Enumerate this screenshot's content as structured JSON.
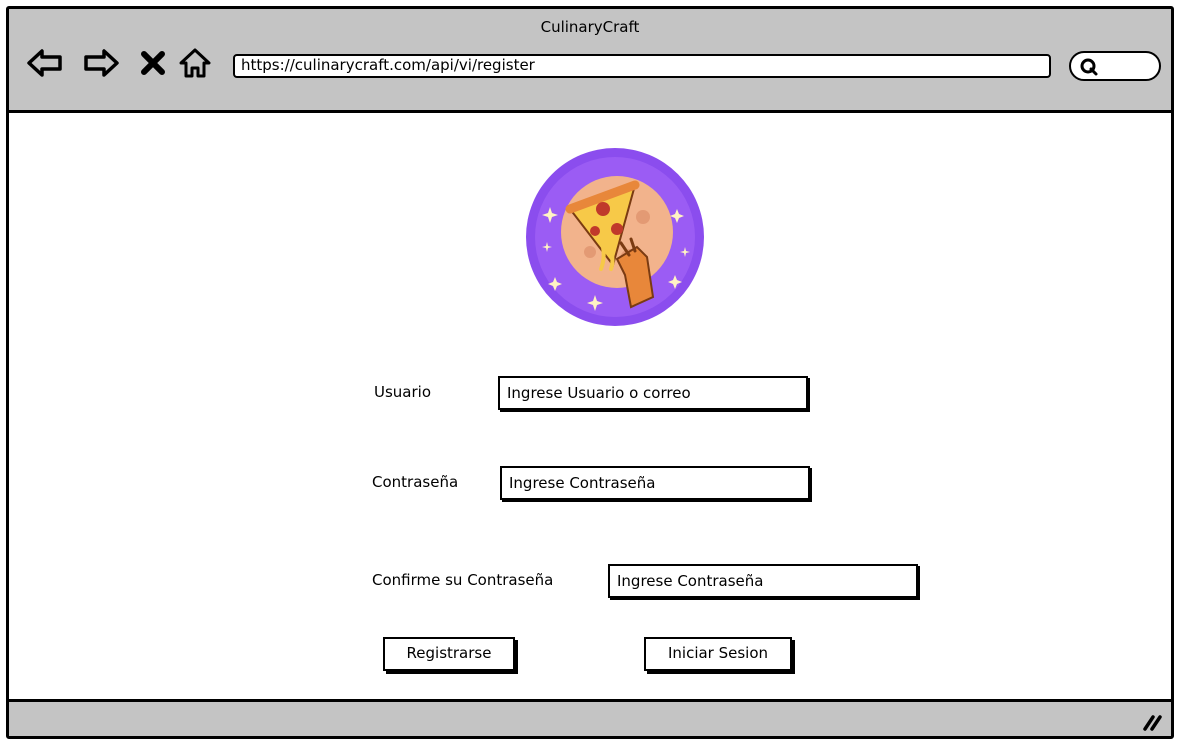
{
  "window": {
    "title": "CulinaryCraft"
  },
  "browser": {
    "url": "https://culinarycraft.com/api/vi/register",
    "icons": [
      "back-arrow-icon",
      "forward-arrow-icon",
      "close-icon",
      "home-icon",
      "search-icon"
    ]
  },
  "logo": {
    "description_icon": "pizza-moon-logo"
  },
  "form": {
    "username_label": "Usuario",
    "username_placeholder": "Ingrese Usuario o correo",
    "password_label": "Contraseña",
    "password_placeholder": "Ingrese Contraseña",
    "confirm_label": "Confirme su Contraseña",
    "confirm_placeholder": "Ingrese Contraseña",
    "register_button": "Registrarse",
    "login_button": "Iniciar Sesion"
  },
  "colors": {
    "chrome": "#c4c4c4",
    "logo_bg": "#8b4dee",
    "moon": "#f2b38c",
    "pizza_cheese": "#f7c948",
    "pizza_crust": "#e8873a",
    "pepperoni": "#c0392b"
  }
}
